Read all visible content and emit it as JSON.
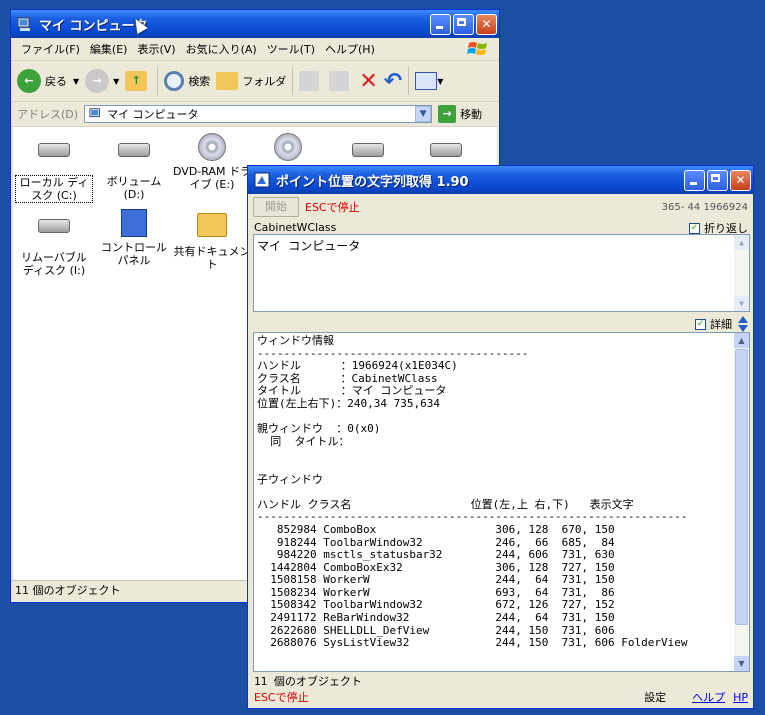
{
  "explorer": {
    "title": "マイ コンピュータ",
    "menu": [
      "ファイル(F)",
      "編集(E)",
      "表示(V)",
      "お気に入り(A)",
      "ツール(T)",
      "ヘルプ(H)"
    ],
    "toolbar": {
      "back": "戻る",
      "search": "検索",
      "folders": "フォルダ"
    },
    "address_label": "アドレス(D)",
    "address_value": "マイ コンピュータ",
    "go_label": "移動",
    "icons": [
      {
        "label": "ローカル ディスク (C:)",
        "kind": "drive"
      },
      {
        "label": "ボリューム (D:)",
        "kind": "drive"
      },
      {
        "label": "DVD-RAM ドライブ (E:)",
        "kind": "dvdram"
      },
      {
        "label": "",
        "kind": "dvd"
      },
      {
        "label": "",
        "kind": "drive"
      },
      {
        "label": "",
        "kind": "drive"
      },
      {
        "label": "リムーバブル ディスク (I:)",
        "kind": "removable"
      },
      {
        "label": "コントロール パネル",
        "kind": "controlpanel"
      },
      {
        "label": "共有ドキュメント",
        "kind": "folder"
      }
    ],
    "status": "11 個のオブジェクト"
  },
  "tool": {
    "title": "ポイント位置の文字列取得 1.90",
    "start_label": "開始",
    "esc_label": "ESCで停止",
    "coords": "365- 44 1966924",
    "class_name": "CabinetWClass",
    "wrap_label": "折り返し",
    "text_value": "マイ コンピュータ",
    "detail_label": "詳細",
    "info_text": "ウィンドウ情報\n-----------------------------------------\nハンドル      ：1966924(x1E034C)\nクラス名      ：CabinetWClass\nタイトル      ：マイ コンピュータ\n位置(左上右下)：240,34 735,634\n\n親ウィンドウ  ：0(x0)\n  同  タイトル：\n\n\n子ウィンドウ\n\nハンドル クラス名                  位置(左,上 右,下)   表示文字\n-----------------------------------------------------------------\n   852984 ComboBox                  306, 128  670, 150\n   918244 ToolbarWindow32           246,  66  685,  84\n   984220 msctls_statusbar32        244, 606  731, 630\n  1442804 ComboBoxEx32              306, 128  727, 150\n  1508158 WorkerW                   244,  64  731, 150\n  1508234 WorkerW                   693,  64  731,  86\n  1508342 ToolbarWindow32           672, 126  727, 152\n  2491172 ReBarWindow32             244,  64  731, 150\n  2622680 SHELLDLL_DefView          244, 150  731, 606\n  2688076 SysListView32             244, 150  731, 606 FolderView",
    "status_line": "11 個のオブジェクト",
    "esc_bottom": "ESCで停止",
    "settings_label": "設定",
    "help_label": "ヘルプ",
    "hp_label": "HP"
  }
}
